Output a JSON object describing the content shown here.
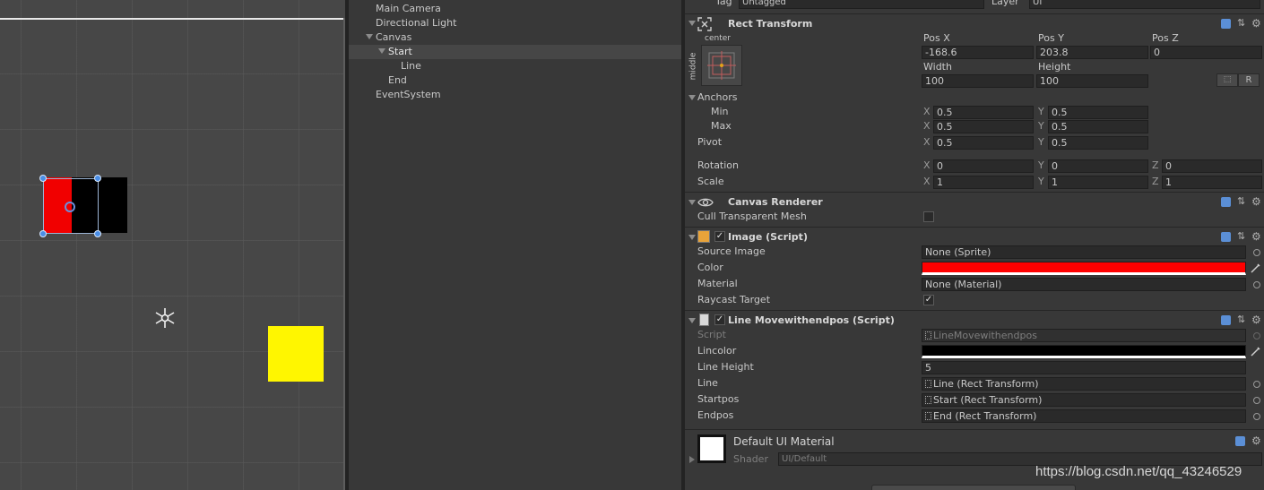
{
  "hierarchy": {
    "items": [
      {
        "label": "Main Camera"
      },
      {
        "label": "Directional Light"
      },
      {
        "label": "Canvas"
      },
      {
        "label": "Start"
      },
      {
        "label": "Line"
      },
      {
        "label": "End"
      },
      {
        "label": "EventSystem"
      }
    ]
  },
  "inspector": {
    "top": {
      "tag_label": "Tag",
      "tag_value": "Untagged",
      "layer_label": "Layer",
      "layer_value": "UI"
    },
    "rect_transform": {
      "title": "Rect Transform",
      "anchor_preset_top": "center",
      "anchor_preset_side": "middle",
      "pos_x_label": "Pos X",
      "pos_y_label": "Pos Y",
      "pos_z_label": "Pos Z",
      "pos_x": "-168.6",
      "pos_y": "203.8",
      "pos_z": "0",
      "width_label": "Width",
      "height_label": "Height",
      "width": "100",
      "height": "100",
      "raw_button": "R",
      "anchors_label": "Anchors",
      "min_label": "Min",
      "max_label": "Max",
      "pivot_label": "Pivot",
      "min_x": "0.5",
      "min_y": "0.5",
      "max_x": "0.5",
      "max_y": "0.5",
      "pivot_x": "0.5",
      "pivot_y": "0.5",
      "rotation_label": "Rotation",
      "scale_label": "Scale",
      "rot_x": "0",
      "rot_y": "0",
      "rot_z": "0",
      "scale_x": "1",
      "scale_y": "1",
      "scale_z": "1",
      "x": "X",
      "y": "Y",
      "z": "Z"
    },
    "canvas_renderer": {
      "title": "Canvas Renderer",
      "cull_label": "Cull Transparent Mesh"
    },
    "image": {
      "title": "Image (Script)",
      "source_image_label": "Source Image",
      "source_image_value": "None (Sprite)",
      "color_label": "Color",
      "color_value": "#ff0000",
      "material_label": "Material",
      "material_value": "None (Material)",
      "raycast_label": "Raycast Target"
    },
    "line_script": {
      "title": "Line Movewithendpos (Script)",
      "script_label": "Script",
      "script_value": "LineMovewithendpos",
      "lincolor_label": "Lincolor",
      "lincolor_value": "#000000",
      "line_height_label": "Line Height",
      "line_height_value": "5",
      "line_label": "Line",
      "line_value": "Line (Rect Transform)",
      "startpos_label": "Startpos",
      "startpos_value": "Start (Rect Transform)",
      "endpos_label": "Endpos",
      "endpos_value": "End (Rect Transform)"
    },
    "material": {
      "name": "Default UI Material",
      "shader_label": "Shader",
      "shader_value": "UI/Default"
    }
  },
  "watermark": "https://blog.csdn.net/qq_43246529",
  "colors": {
    "start_red": "#f10000",
    "end_yellow": "#fff600",
    "selection_blue": "#4a8ee6"
  }
}
